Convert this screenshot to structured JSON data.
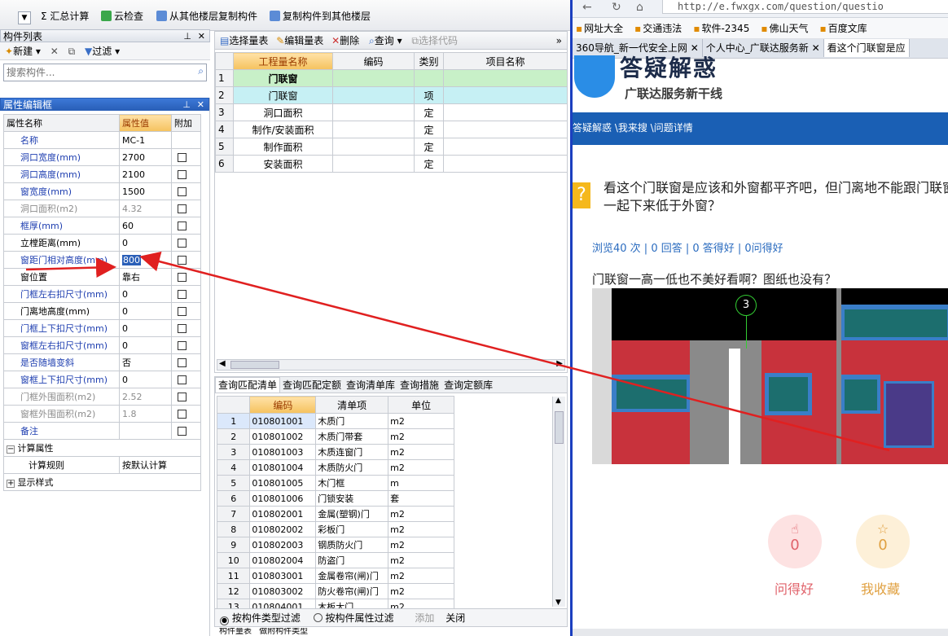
{
  "toolbar": {
    "items": [
      "Σ 汇总计算",
      "云检查",
      "从其他楼层复制构件",
      "复制构件到其他楼层"
    ]
  },
  "component_list": {
    "title": "构件列表",
    "new_label": "新建",
    "filter_label": "过滤",
    "search_placeholder": "搜索构件..."
  },
  "property_panel": {
    "title": "属性编辑框",
    "headers": [
      "属性名称",
      "属性值",
      "附加"
    ],
    "rows": [
      {
        "name": "名称",
        "value": "MC-1",
        "style": "blue",
        "check": false
      },
      {
        "name": "洞口宽度(mm)",
        "value": "2700",
        "style": "blue",
        "check": true
      },
      {
        "name": "洞口高度(mm)",
        "value": "2100",
        "style": "blue",
        "check": true
      },
      {
        "name": "窗宽度(mm)",
        "value": "1500",
        "style": "blue",
        "check": true
      },
      {
        "name": "洞口面积(m2)",
        "value": "4.32",
        "style": "gray",
        "check": true
      },
      {
        "name": "框厚(mm)",
        "value": "60",
        "style": "blue",
        "check": true
      },
      {
        "name": "立樘距离(mm)",
        "value": "0",
        "style": "black",
        "check": true
      },
      {
        "name": "窗距门相对高度(mm)",
        "value": "800",
        "style": "blue",
        "check": true,
        "selected": true
      },
      {
        "name": "窗位置",
        "value": "靠右",
        "style": "black",
        "check": true
      },
      {
        "name": "门框左右扣尺寸(mm)",
        "value": "0",
        "style": "blue",
        "check": true
      },
      {
        "name": "门离地高度(mm)",
        "value": "0",
        "style": "black",
        "check": true
      },
      {
        "name": "门框上下扣尺寸(mm)",
        "value": "0",
        "style": "blue",
        "check": true
      },
      {
        "name": "窗框左右扣尺寸(mm)",
        "value": "0",
        "style": "blue",
        "check": true
      },
      {
        "name": "是否随墙变斜",
        "value": "否",
        "style": "blue",
        "check": true
      },
      {
        "name": "窗框上下扣尺寸(mm)",
        "value": "0",
        "style": "blue",
        "check": true
      },
      {
        "name": "门框外围面积(m2)",
        "value": "2.52",
        "style": "gray",
        "check": true
      },
      {
        "name": "窗框外围面积(m2)",
        "value": "1.8",
        "style": "gray",
        "check": true
      },
      {
        "name": "备注",
        "value": "",
        "style": "blue",
        "check": true
      }
    ],
    "group_calc": "计算属性",
    "calc_rule_label": "计算规则",
    "calc_rule_value": "按默认计算",
    "group_display": "显示样式"
  },
  "quantity_table": {
    "toolbar": [
      "选择量表",
      "编辑量表",
      "删除",
      "查询",
      "选择代码"
    ],
    "headers": [
      "工程量名称",
      "编码",
      "类别",
      "项目名称"
    ],
    "rows": [
      {
        "n": "1",
        "name": "门联窗",
        "code": "",
        "type": ""
      },
      {
        "n": "2",
        "name": "门联窗",
        "code": "",
        "type": "项"
      },
      {
        "n": "3",
        "name": "洞口面积",
        "code": "",
        "type": "定"
      },
      {
        "n": "4",
        "name": "制作/安装面积",
        "code": "",
        "type": "定"
      },
      {
        "n": "5",
        "name": "制作面积",
        "code": "",
        "type": "定"
      },
      {
        "n": "6",
        "name": "安装面积",
        "code": "",
        "type": "定"
      }
    ]
  },
  "match_panel": {
    "tabs": [
      "查询匹配清单",
      "查询匹配定额",
      "查询清单库",
      "查询措施",
      "查询定额库"
    ],
    "headers": [
      "编码",
      "清单项",
      "单位"
    ],
    "rows": [
      [
        "1",
        "010801001",
        "木质门",
        "m2"
      ],
      [
        "2",
        "010801002",
        "木质门带套",
        "m2"
      ],
      [
        "3",
        "010801003",
        "木质连窗门",
        "m2"
      ],
      [
        "4",
        "010801004",
        "木质防火门",
        "m2"
      ],
      [
        "5",
        "010801005",
        "木门框",
        "m"
      ],
      [
        "6",
        "010801006",
        "门锁安装",
        "套"
      ],
      [
        "7",
        "010802001",
        "金属(塑钢)门",
        "m2"
      ],
      [
        "8",
        "010802002",
        "彩板门",
        "m2"
      ],
      [
        "9",
        "010802003",
        "钢质防火门",
        "m2"
      ],
      [
        "10",
        "010802004",
        "防盗门",
        "m2"
      ],
      [
        "11",
        "010803001",
        "金属卷帘(闸)门",
        "m2"
      ],
      [
        "12",
        "010803002",
        "防火卷帘(闸)门",
        "m2"
      ],
      [
        "13",
        "010804001",
        "木板大门",
        "m2"
      ]
    ],
    "radio1": "按构件类型过滤",
    "radio2": "按构件属性过滤",
    "add_label": "添加",
    "close_label": "关闭",
    "bottom_tabs": [
      "构件量表",
      "做附构件类型"
    ]
  },
  "browser": {
    "url": "http://e.fwxgx.com/question/questio",
    "bookmarks": [
      "网址大全",
      "交通违法",
      "软件-2345",
      "佛山天气",
      "百度文库"
    ],
    "tabs": [
      "360导航_新一代安全上网",
      "个人中心_广联达服务新",
      "看这个门联窗是应"
    ],
    "logo_text": "答疑解惑",
    "logo_sub": "广联达服务新干线",
    "breadcrumb": "答疑解惑 \\我来搜 \\问题详情",
    "question": "看这个门联窗是应该和外窗都平齐吧，但门离地不能跟门联窗一起下来低于外窗？",
    "stats": "浏览40 次 | 0 回答 | 0 答得好 | 0问得好",
    "desc": "门联窗一高一低也不美好看啊？图纸也没有？",
    "axis_label": "3",
    "like_count": "0",
    "like_label": "问得好",
    "fav_count": "0",
    "fav_label": "我收藏"
  }
}
